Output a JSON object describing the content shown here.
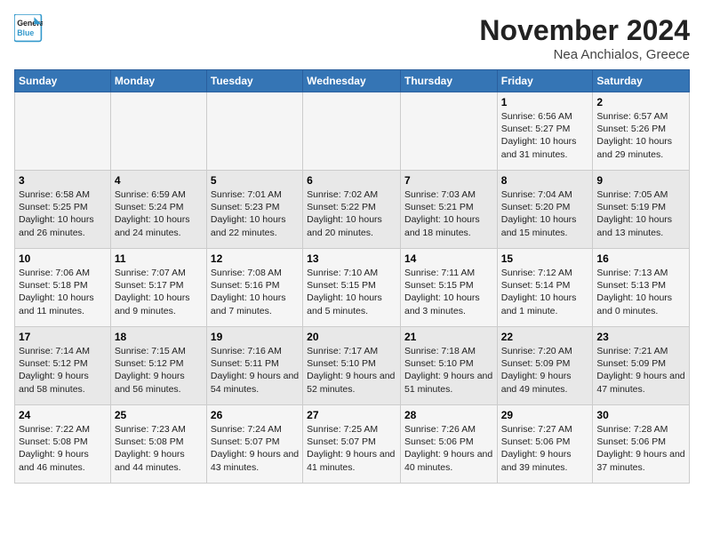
{
  "logo": {
    "line1": "General",
    "line2": "Blue"
  },
  "title": "November 2024",
  "location": "Nea Anchialos, Greece",
  "days_of_week": [
    "Sunday",
    "Monday",
    "Tuesday",
    "Wednesday",
    "Thursday",
    "Friday",
    "Saturday"
  ],
  "weeks": [
    [
      {
        "num": "",
        "info": ""
      },
      {
        "num": "",
        "info": ""
      },
      {
        "num": "",
        "info": ""
      },
      {
        "num": "",
        "info": ""
      },
      {
        "num": "",
        "info": ""
      },
      {
        "num": "1",
        "info": "Sunrise: 6:56 AM\nSunset: 5:27 PM\nDaylight: 10 hours and 31 minutes."
      },
      {
        "num": "2",
        "info": "Sunrise: 6:57 AM\nSunset: 5:26 PM\nDaylight: 10 hours and 29 minutes."
      }
    ],
    [
      {
        "num": "3",
        "info": "Sunrise: 6:58 AM\nSunset: 5:25 PM\nDaylight: 10 hours and 26 minutes."
      },
      {
        "num": "4",
        "info": "Sunrise: 6:59 AM\nSunset: 5:24 PM\nDaylight: 10 hours and 24 minutes."
      },
      {
        "num": "5",
        "info": "Sunrise: 7:01 AM\nSunset: 5:23 PM\nDaylight: 10 hours and 22 minutes."
      },
      {
        "num": "6",
        "info": "Sunrise: 7:02 AM\nSunset: 5:22 PM\nDaylight: 10 hours and 20 minutes."
      },
      {
        "num": "7",
        "info": "Sunrise: 7:03 AM\nSunset: 5:21 PM\nDaylight: 10 hours and 18 minutes."
      },
      {
        "num": "8",
        "info": "Sunrise: 7:04 AM\nSunset: 5:20 PM\nDaylight: 10 hours and 15 minutes."
      },
      {
        "num": "9",
        "info": "Sunrise: 7:05 AM\nSunset: 5:19 PM\nDaylight: 10 hours and 13 minutes."
      }
    ],
    [
      {
        "num": "10",
        "info": "Sunrise: 7:06 AM\nSunset: 5:18 PM\nDaylight: 10 hours and 11 minutes."
      },
      {
        "num": "11",
        "info": "Sunrise: 7:07 AM\nSunset: 5:17 PM\nDaylight: 10 hours and 9 minutes."
      },
      {
        "num": "12",
        "info": "Sunrise: 7:08 AM\nSunset: 5:16 PM\nDaylight: 10 hours and 7 minutes."
      },
      {
        "num": "13",
        "info": "Sunrise: 7:10 AM\nSunset: 5:15 PM\nDaylight: 10 hours and 5 minutes."
      },
      {
        "num": "14",
        "info": "Sunrise: 7:11 AM\nSunset: 5:15 PM\nDaylight: 10 hours and 3 minutes."
      },
      {
        "num": "15",
        "info": "Sunrise: 7:12 AM\nSunset: 5:14 PM\nDaylight: 10 hours and 1 minute."
      },
      {
        "num": "16",
        "info": "Sunrise: 7:13 AM\nSunset: 5:13 PM\nDaylight: 10 hours and 0 minutes."
      }
    ],
    [
      {
        "num": "17",
        "info": "Sunrise: 7:14 AM\nSunset: 5:12 PM\nDaylight: 9 hours and 58 minutes."
      },
      {
        "num": "18",
        "info": "Sunrise: 7:15 AM\nSunset: 5:12 PM\nDaylight: 9 hours and 56 minutes."
      },
      {
        "num": "19",
        "info": "Sunrise: 7:16 AM\nSunset: 5:11 PM\nDaylight: 9 hours and 54 minutes."
      },
      {
        "num": "20",
        "info": "Sunrise: 7:17 AM\nSunset: 5:10 PM\nDaylight: 9 hours and 52 minutes."
      },
      {
        "num": "21",
        "info": "Sunrise: 7:18 AM\nSunset: 5:10 PM\nDaylight: 9 hours and 51 minutes."
      },
      {
        "num": "22",
        "info": "Sunrise: 7:20 AM\nSunset: 5:09 PM\nDaylight: 9 hours and 49 minutes."
      },
      {
        "num": "23",
        "info": "Sunrise: 7:21 AM\nSunset: 5:09 PM\nDaylight: 9 hours and 47 minutes."
      }
    ],
    [
      {
        "num": "24",
        "info": "Sunrise: 7:22 AM\nSunset: 5:08 PM\nDaylight: 9 hours and 46 minutes."
      },
      {
        "num": "25",
        "info": "Sunrise: 7:23 AM\nSunset: 5:08 PM\nDaylight: 9 hours and 44 minutes."
      },
      {
        "num": "26",
        "info": "Sunrise: 7:24 AM\nSunset: 5:07 PM\nDaylight: 9 hours and 43 minutes."
      },
      {
        "num": "27",
        "info": "Sunrise: 7:25 AM\nSunset: 5:07 PM\nDaylight: 9 hours and 41 minutes."
      },
      {
        "num": "28",
        "info": "Sunrise: 7:26 AM\nSunset: 5:06 PM\nDaylight: 9 hours and 40 minutes."
      },
      {
        "num": "29",
        "info": "Sunrise: 7:27 AM\nSunset: 5:06 PM\nDaylight: 9 hours and 39 minutes."
      },
      {
        "num": "30",
        "info": "Sunrise: 7:28 AM\nSunset: 5:06 PM\nDaylight: 9 hours and 37 minutes."
      }
    ]
  ]
}
